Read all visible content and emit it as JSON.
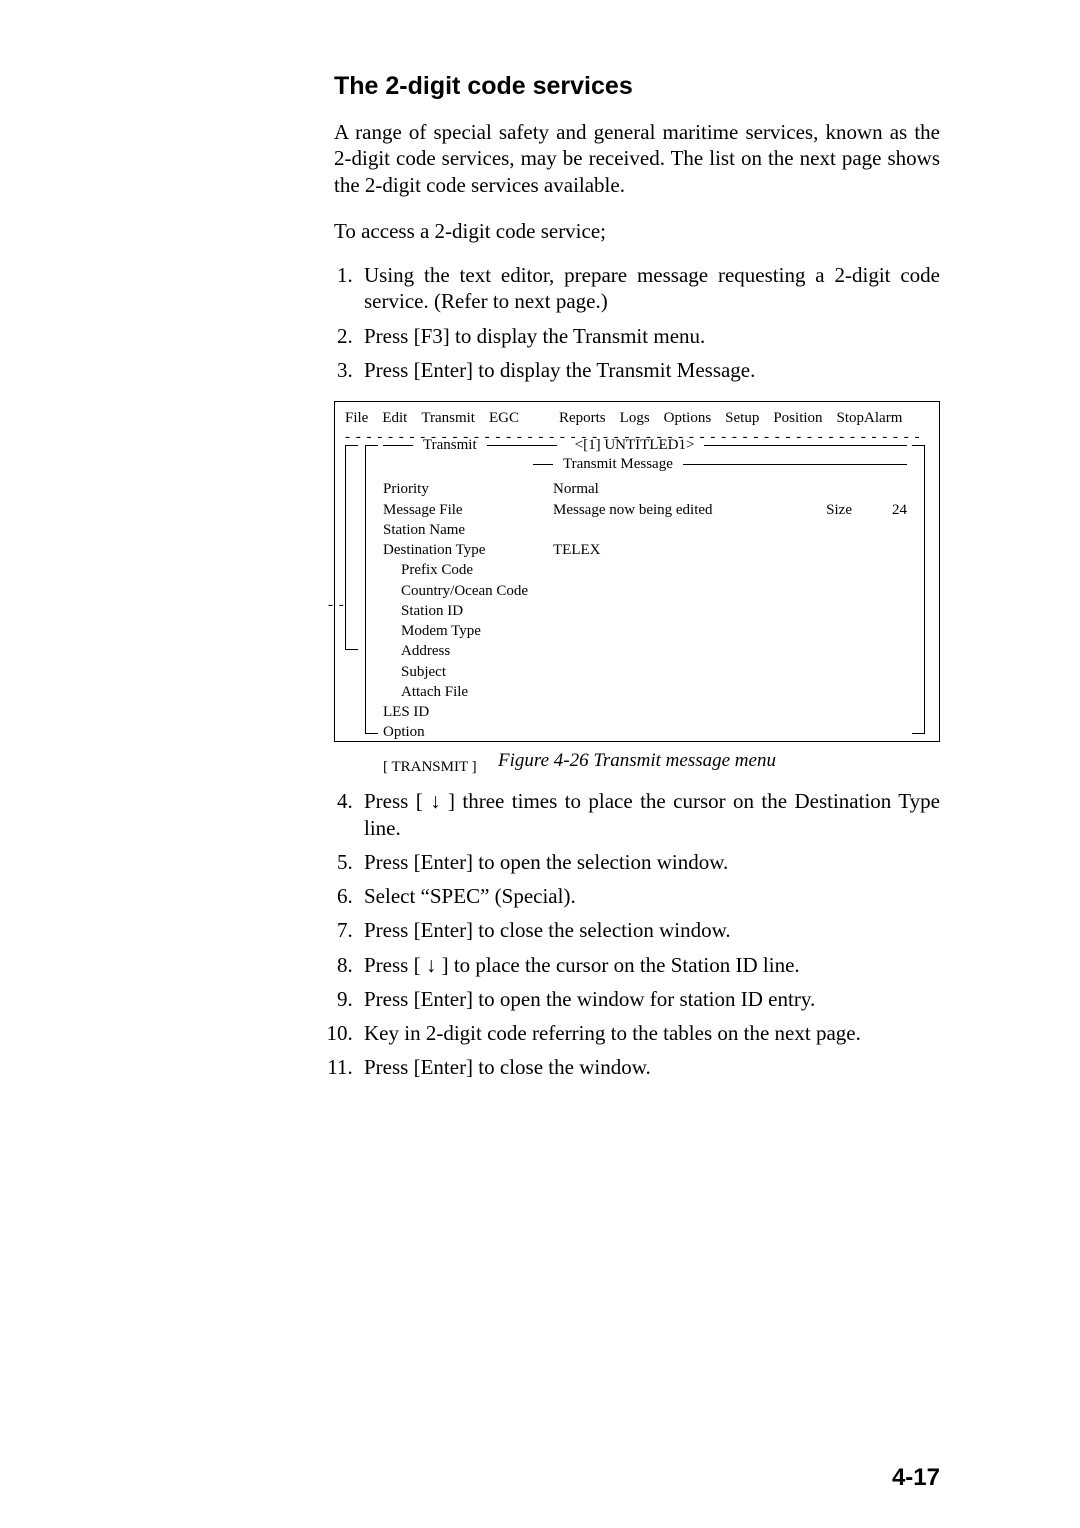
{
  "heading": "The 2-digit code services",
  "intro_p1": "A range of special safety and general maritime services, known as the 2-digit code services, may be received. The list on the next page shows the 2-digit code services available.",
  "intro_p2": "To access a 2-digit code service;",
  "steps_a": [
    "Using the text editor, prepare message requesting a 2-digit code service. (Refer to next page.)",
    "Press [F3] to display the Transmit menu.",
    "Press [Enter] to display the Transmit Message."
  ],
  "figure": {
    "menubar": [
      "File",
      "Edit",
      "Transmit",
      "EGC",
      "Reports",
      "Logs",
      "Options",
      "Setup",
      "Position",
      "StopAlarm"
    ],
    "outer_panel_dashes": "- -",
    "title_transmit": "Transmit",
    "title_tab": "<[1] UNTITLED1>",
    "title_transmit_message": "Transmit Message",
    "rows": {
      "priority": {
        "label": "Priority",
        "value": "Normal"
      },
      "message_file": {
        "label": "Message File",
        "value": "Message now being edited",
        "size_label": "Size",
        "size_value": "24"
      },
      "station_name": {
        "label": "Station Name",
        "value": ""
      },
      "destination_type": {
        "label": "Destination Type",
        "value": "TELEX"
      },
      "prefix_code": {
        "label": "Prefix Code"
      },
      "country_ocean": {
        "label": "Country/Ocean Code"
      },
      "station_id": {
        "label": "Station ID"
      },
      "modem_type": {
        "label": "Modem Type"
      },
      "address": {
        "label": "Address"
      },
      "subject": {
        "label": "Subject"
      },
      "attach_file": {
        "label": "Attach File"
      },
      "les_id": {
        "label": "LES ID"
      },
      "option": {
        "label": "Option"
      }
    },
    "transmit_button": "[   TRANSMIT   ]",
    "caption": "Figure 4-26 Transmit message menu"
  },
  "steps_b": [
    "Press [ ↓ ] three times to place the cursor on the Destination Type line.",
    "Press [Enter] to open the selection window.",
    "Select “SPEC” (Special).",
    "Press [Enter] to close the selection window.",
    "Press [ ↓ ] to place the cursor on the Station ID line.",
    "Press [Enter] to open the window for station ID entry.",
    "Key in 2-digit code referring to the tables on the next page.",
    "Press [Enter] to close the window."
  ],
  "page_number": "4-17"
}
